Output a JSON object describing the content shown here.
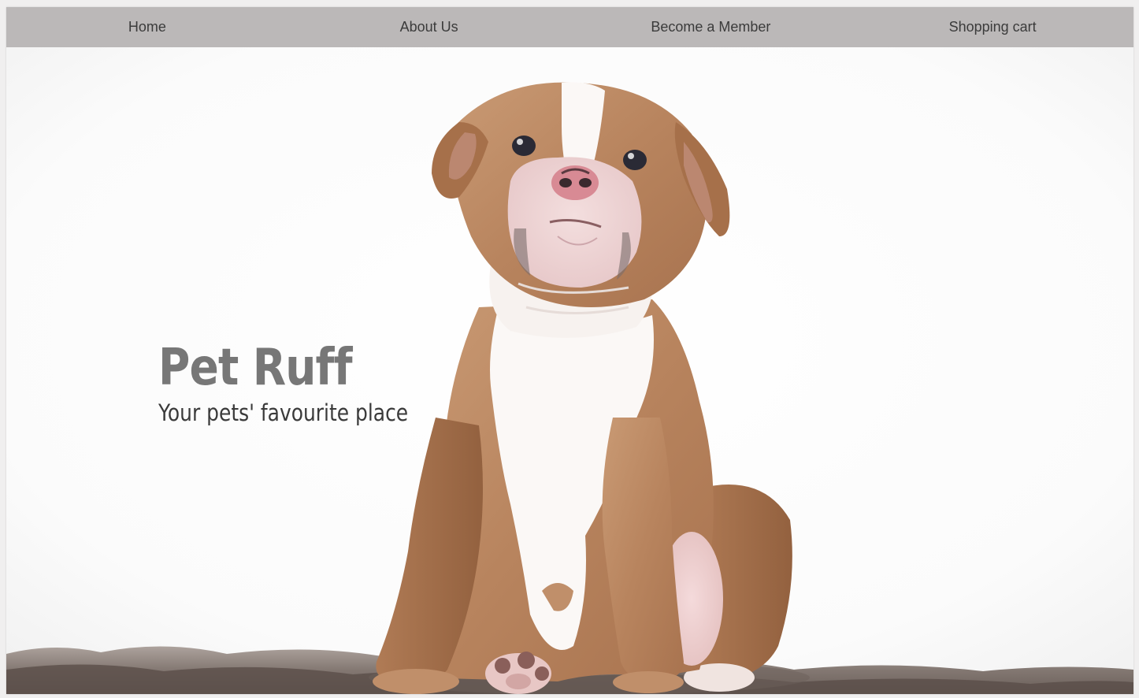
{
  "nav": {
    "items": [
      {
        "label": "Home"
      },
      {
        "label": "About Us"
      },
      {
        "label": "Become a Member"
      },
      {
        "label": "Shopping cart"
      }
    ]
  },
  "hero": {
    "title": "Pet Ruff",
    "subtitle": "Your pets' favourite place",
    "image_subject": "puppy-photo"
  },
  "colors": {
    "nav_background": "#bbb8b8",
    "nav_text": "#3b3b3b",
    "title_color": "#777777",
    "subtitle_color": "#3a3a3a",
    "page_background": "#ffffff"
  }
}
